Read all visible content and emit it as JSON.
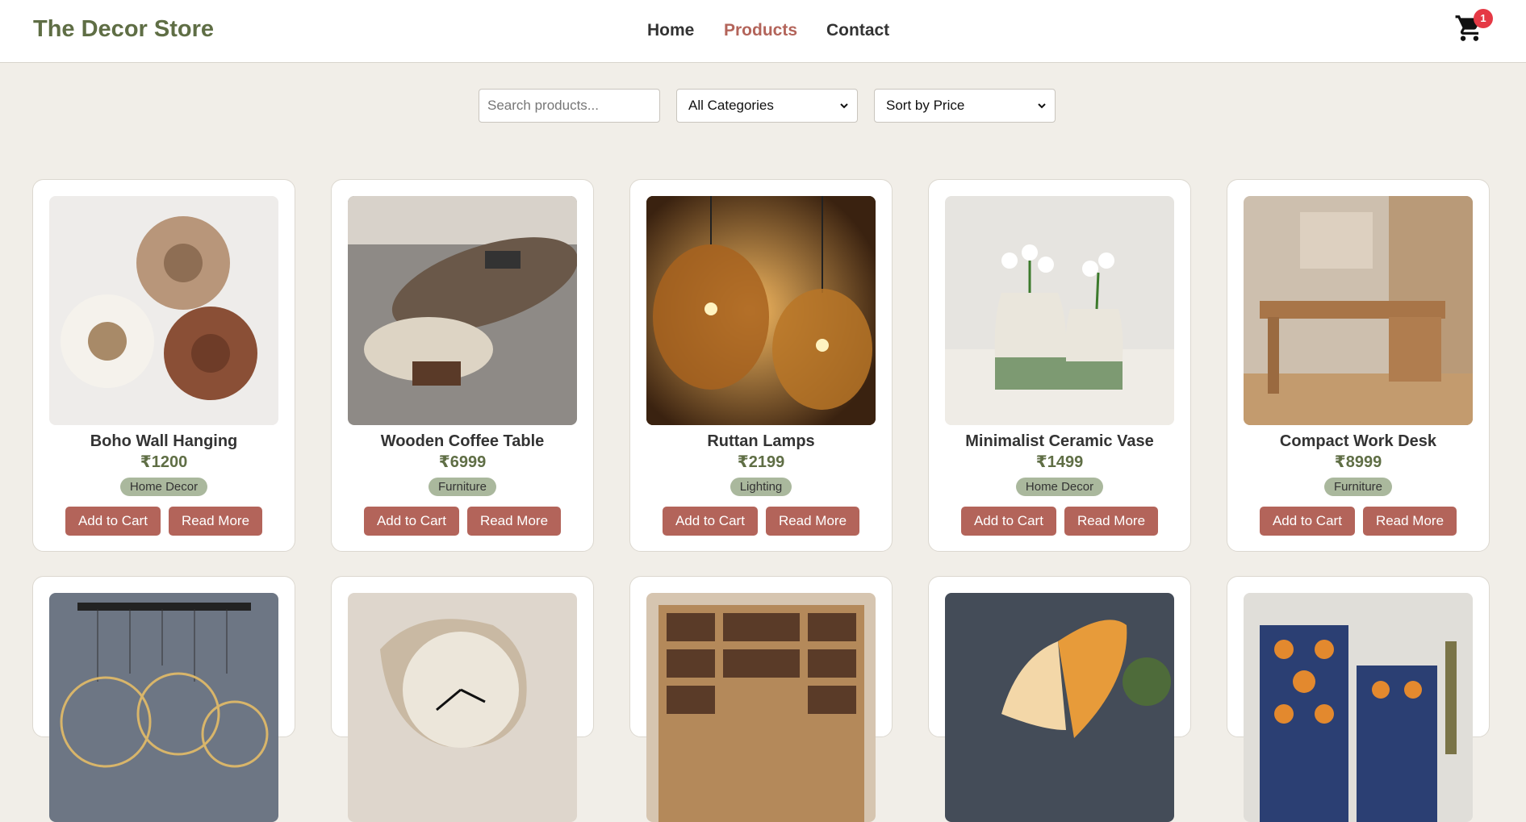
{
  "header": {
    "brand": "The Decor Store",
    "nav": [
      {
        "label": "Home"
      },
      {
        "label": "Products"
      },
      {
        "label": "Contact"
      }
    ],
    "cart": {
      "count": "1",
      "icon": "cart-icon"
    }
  },
  "filters": {
    "search_placeholder": "Search products...",
    "category_selected": "All Categories",
    "sort_selected": "Sort by Price"
  },
  "products": [
    {
      "title": "Boho Wall Hanging",
      "price": "₹1200",
      "tag": "Home Decor",
      "add": "Add to Cart",
      "more": "Read More"
    },
    {
      "title": "Wooden Coffee Table",
      "price": "₹6999",
      "tag": "Furniture",
      "add": "Add to Cart",
      "more": "Read More"
    },
    {
      "title": "Ruttan Lamps",
      "price": "₹2199",
      "tag": "Lighting",
      "add": "Add to Cart",
      "more": "Read More"
    },
    {
      "title": "Minimalist Ceramic Vase",
      "price": "₹1499",
      "tag": "Home Decor",
      "add": "Add to Cart",
      "more": "Read More"
    },
    {
      "title": "Compact Work Desk",
      "price": "₹8999",
      "tag": "Furniture",
      "add": "Add to Cart",
      "more": "Read More"
    }
  ],
  "colors": {
    "brand": "#5f6e45",
    "accent": "#b3645a",
    "tag_bg": "#aab89d",
    "page_bg": "#f1eee8",
    "badge": "#e53945"
  }
}
